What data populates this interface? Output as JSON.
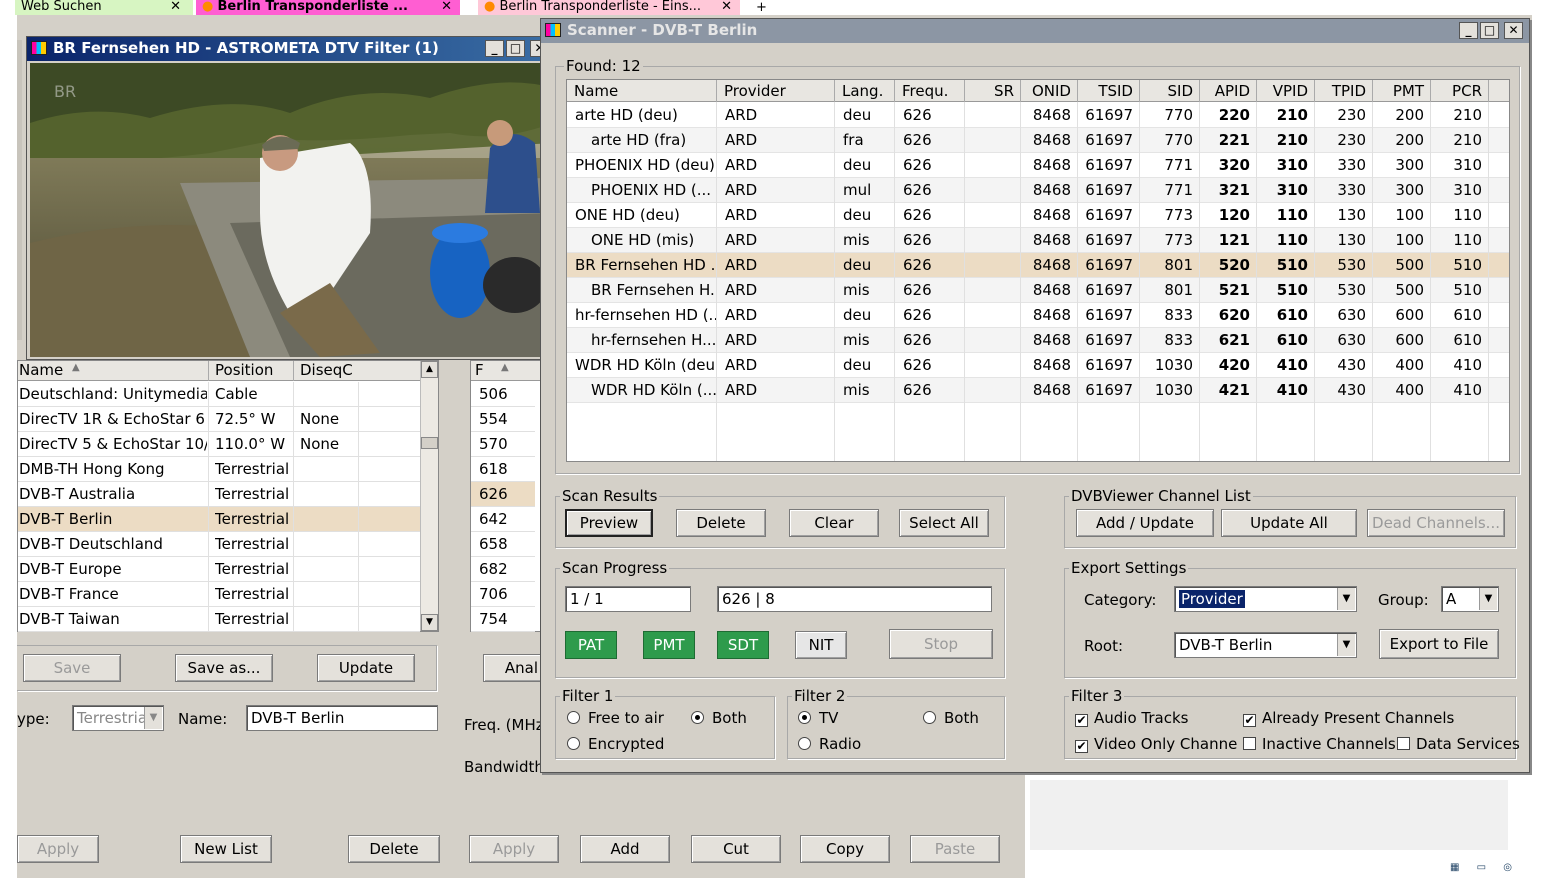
{
  "browser_tabs": [
    {
      "label": "Web Suchen"
    },
    {
      "label": "Berlin Transponderliste ..."
    },
    {
      "label": "Berlin Transponderliste - Eins..."
    }
  ],
  "preview_window": {
    "title": "BR Fernsehen HD - ASTROMETA DTV Filter (1)",
    "watermark": "BR"
  },
  "satellite_list": {
    "columns": [
      "Name",
      "Position",
      "DiseqC"
    ],
    "rows": [
      {
        "name": "Deutschland: Unitymedia",
        "position": "Cable",
        "diseqc": ""
      },
      {
        "name": "DirecTV 1R & EchoStar 6 ...",
        "position": "72.5° W",
        "diseqc": "None"
      },
      {
        "name": "DirecTV 5 & EchoStar 10/...",
        "position": "110.0° W",
        "diseqc": "None"
      },
      {
        "name": "DMB-TH Hong Kong",
        "position": "Terrestrial",
        "diseqc": ""
      },
      {
        "name": "DVB-T Australia",
        "position": "Terrestrial",
        "diseqc": ""
      },
      {
        "name": "DVB-T Berlin",
        "position": "Terrestrial",
        "diseqc": ""
      },
      {
        "name": "DVB-T Deutschland",
        "position": "Terrestrial",
        "diseqc": ""
      },
      {
        "name": "DVB-T Europe",
        "position": "Terrestrial",
        "diseqc": ""
      },
      {
        "name": "DVB-T France",
        "position": "Terrestrial",
        "diseqc": ""
      },
      {
        "name": "DVB-T Taiwan",
        "position": "Terrestrial",
        "diseqc": ""
      }
    ],
    "selected_index": 5,
    "buttons": {
      "save": "Save",
      "save_as": "Save as...",
      "update": "Update"
    },
    "type_label": "ype:",
    "type_value": "Terrestria",
    "name_label": "Name:",
    "name_value": "DVB-T Berlin",
    "bottom_buttons": {
      "apply": "Apply",
      "new_list": "New List",
      "delete": "Delete"
    }
  },
  "freq_list": {
    "column": "F",
    "rows": [
      "506",
      "554",
      "570",
      "618",
      "626",
      "642",
      "658",
      "682",
      "706",
      "754"
    ],
    "selected_index": 4,
    "anal_button": "Anal",
    "freq_label": "Freq. (MHz",
    "bandwidth_label": "Bandwidth",
    "bottom_buttons": {
      "apply": "Apply",
      "add": "Add",
      "cut": "Cut",
      "copy": "Copy",
      "paste": "Paste"
    }
  },
  "scanner": {
    "title": "Scanner - DVB-T Berlin",
    "found_label": "Found:",
    "found_count": "12",
    "columns": [
      "Name",
      "Provider",
      "Lang.",
      "Frequ.",
      "SR",
      "ONID",
      "TSID",
      "SID",
      "APID",
      "VPID",
      "TPID",
      "PMT",
      "PCR"
    ],
    "rows": [
      {
        "name": "arte HD (deu)",
        "indent": false,
        "provider": "ARD",
        "lang": "deu",
        "freq": "626",
        "sr": "",
        "onid": "8468",
        "tsid": "61697",
        "sid": "770",
        "apid": "220",
        "vpid": "210",
        "tpid": "230",
        "pmt": "200",
        "pcr": "210"
      },
      {
        "name": "arte HD (fra)",
        "indent": true,
        "provider": "ARD",
        "lang": "fra",
        "freq": "626",
        "sr": "",
        "onid": "8468",
        "tsid": "61697",
        "sid": "770",
        "apid": "221",
        "vpid": "210",
        "tpid": "230",
        "pmt": "200",
        "pcr": "210"
      },
      {
        "name": "PHOENIX HD (deu)",
        "indent": false,
        "provider": "ARD",
        "lang": "deu",
        "freq": "626",
        "sr": "",
        "onid": "8468",
        "tsid": "61697",
        "sid": "771",
        "apid": "320",
        "vpid": "310",
        "tpid": "330",
        "pmt": "300",
        "pcr": "310"
      },
      {
        "name": "PHOENIX HD (...",
        "indent": true,
        "provider": "ARD",
        "lang": "mul",
        "freq": "626",
        "sr": "",
        "onid": "8468",
        "tsid": "61697",
        "sid": "771",
        "apid": "321",
        "vpid": "310",
        "tpid": "330",
        "pmt": "300",
        "pcr": "310"
      },
      {
        "name": "ONE HD (deu)",
        "indent": false,
        "provider": "ARD",
        "lang": "deu",
        "freq": "626",
        "sr": "",
        "onid": "8468",
        "tsid": "61697",
        "sid": "773",
        "apid": "120",
        "vpid": "110",
        "tpid": "130",
        "pmt": "100",
        "pcr": "110"
      },
      {
        "name": "ONE HD (mis)",
        "indent": true,
        "provider": "ARD",
        "lang": "mis",
        "freq": "626",
        "sr": "",
        "onid": "8468",
        "tsid": "61697",
        "sid": "773",
        "apid": "121",
        "vpid": "110",
        "tpid": "130",
        "pmt": "100",
        "pcr": "110"
      },
      {
        "name": "BR Fernsehen HD ...",
        "indent": false,
        "provider": "ARD",
        "lang": "deu",
        "freq": "626",
        "sr": "",
        "onid": "8468",
        "tsid": "61697",
        "sid": "801",
        "apid": "520",
        "vpid": "510",
        "tpid": "530",
        "pmt": "500",
        "pcr": "510"
      },
      {
        "name": "BR Fernsehen H...",
        "indent": true,
        "provider": "ARD",
        "lang": "mis",
        "freq": "626",
        "sr": "",
        "onid": "8468",
        "tsid": "61697",
        "sid": "801",
        "apid": "521",
        "vpid": "510",
        "tpid": "530",
        "pmt": "500",
        "pcr": "510"
      },
      {
        "name": "hr-fernsehen HD (...",
        "indent": false,
        "provider": "ARD",
        "lang": "deu",
        "freq": "626",
        "sr": "",
        "onid": "8468",
        "tsid": "61697",
        "sid": "833",
        "apid": "620",
        "vpid": "610",
        "tpid": "630",
        "pmt": "600",
        "pcr": "610"
      },
      {
        "name": "hr-fernsehen H...",
        "indent": true,
        "provider": "ARD",
        "lang": "mis",
        "freq": "626",
        "sr": "",
        "onid": "8468",
        "tsid": "61697",
        "sid": "833",
        "apid": "621",
        "vpid": "610",
        "tpid": "630",
        "pmt": "600",
        "pcr": "610"
      },
      {
        "name": "WDR HD Köln (deu)",
        "indent": false,
        "provider": "ARD",
        "lang": "deu",
        "freq": "626",
        "sr": "",
        "onid": "8468",
        "tsid": "61697",
        "sid": "1030",
        "apid": "420",
        "vpid": "410",
        "tpid": "430",
        "pmt": "400",
        "pcr": "410"
      },
      {
        "name": "WDR HD Köln (...",
        "indent": true,
        "provider": "ARD",
        "lang": "mis",
        "freq": "626",
        "sr": "",
        "onid": "8468",
        "tsid": "61697",
        "sid": "1030",
        "apid": "421",
        "vpid": "410",
        "tpid": "430",
        "pmt": "400",
        "pcr": "410"
      }
    ],
    "selected_index": 6,
    "scan_results": {
      "title": "Scan Results",
      "preview": "Preview",
      "delete": "Delete",
      "clear": "Clear",
      "select_all": "Select All"
    },
    "dvbviewer": {
      "title": "DVBViewer Channel List",
      "add_update": "Add / Update",
      "update_all": "Update All",
      "dead_channels": "Dead Channels..."
    },
    "scan_progress": {
      "title": "Scan Progress",
      "counter": "1 / 1",
      "transponder": "626 | 8",
      "pat": "PAT",
      "pmt": "PMT",
      "sdt": "SDT",
      "nit": "NIT",
      "stop": "Stop"
    },
    "export_settings": {
      "title": "Export Settings",
      "category_label": "Category:",
      "category_value": "Provider",
      "group_label": "Group:",
      "group_value": "A",
      "root_label": "Root:",
      "root_value": "DVB-T Berlin",
      "export_button": "Export to File"
    },
    "filter1": {
      "title": "Filter 1",
      "free_to_air": "Free to air",
      "both": "Both",
      "encrypted": "Encrypted",
      "selected": "both"
    },
    "filter2": {
      "title": "Filter 2",
      "tv": "TV",
      "both": "Both",
      "radio": "Radio",
      "selected": "tv"
    },
    "filter3": {
      "title": "Filter 3",
      "audio_tracks": "Audio Tracks",
      "already_present": "Already Present Channels",
      "video_only": "Video Only Channe",
      "inactive": "Inactive Channels",
      "data_services": "Data Services",
      "checked": {
        "audio_tracks": true,
        "already_present": true,
        "video_only": true,
        "inactive": false,
        "data_services": false
      }
    }
  },
  "colors": {
    "title_active": "#0a246a",
    "title_inactive": "#7f8c9c",
    "selection": "#ecdcc4",
    "green": "#2e9b4c"
  }
}
